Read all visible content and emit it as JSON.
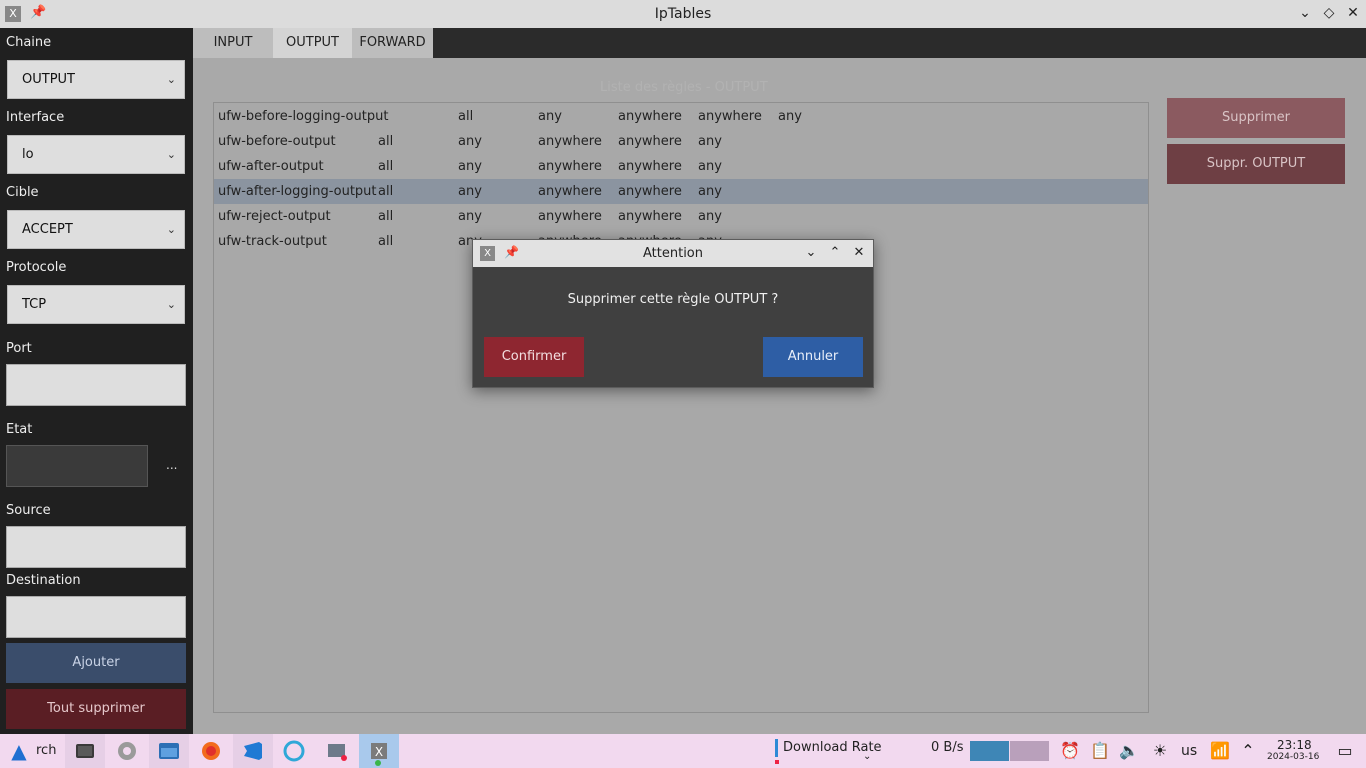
{
  "window": {
    "title": "IpTables",
    "app_icon_glyph": "X",
    "pin_glyph": "📌",
    "minimize_glyph": "⌄",
    "maximize_glyph": "◇",
    "close_glyph": "✕"
  },
  "left_panel": {
    "chaine_label": "Chaine",
    "chaine_value": "OUTPUT",
    "interface_label": "Interface",
    "interface_value": "lo",
    "cible_label": "Cible",
    "cible_value": "ACCEPT",
    "protocole_label": "Protocole",
    "protocole_value": "TCP",
    "port_label": "Port",
    "port_value": "",
    "etat_label": "Etat",
    "etat_value": "",
    "etat_more": "...",
    "source_label": "Source",
    "source_value": "",
    "destination_label": "Destination",
    "destination_value": "",
    "add_button": "Ajouter",
    "clear_all_button": "Tout supprimer",
    "chevron_glyph": "⌄"
  },
  "tabs": [
    "INPUT",
    "OUTPUT",
    "FORWARD"
  ],
  "active_tab": "OUTPUT",
  "main": {
    "faded_title": "Liste des règles - OUTPUT",
    "rows": [
      [
        "ufw-before-logging-output",
        "",
        "all",
        "any",
        "anywhere",
        "anywhere",
        "any"
      ],
      [
        "ufw-before-output",
        "all",
        "any",
        "anywhere",
        "anywhere",
        "any",
        ""
      ],
      [
        "ufw-after-output",
        "all",
        "any",
        "anywhere",
        "anywhere",
        "any",
        ""
      ],
      [
        "ufw-after-logging-output",
        "all",
        "any",
        "anywhere",
        "anywhere",
        "any",
        ""
      ],
      [
        "ufw-reject-output",
        "all",
        "any",
        "anywhere",
        "anywhere",
        "any",
        ""
      ],
      [
        "ufw-track-output",
        "all",
        "any",
        "anywhere",
        "anywhere",
        "any",
        ""
      ]
    ],
    "selected_row": 3,
    "delete_button": "Supprimer",
    "delete_output_button": "Suppr. OUTPUT"
  },
  "dialog": {
    "title": "Attention",
    "message": "Supprimer cette règle OUTPUT ?",
    "confirm_button": "Confirmer",
    "cancel_button": "Annuler",
    "minimize_glyph": "⌄",
    "maximize_glyph": "⌃",
    "close_glyph": "✕"
  },
  "taskbar": {
    "launcher_label": "rch",
    "download_label": "Download Rate",
    "download_value": "0 B/s",
    "keyboard_layout": "us",
    "time": "23:18",
    "date": "2024-03-16"
  },
  "colors": {
    "confirm": "#8e2630",
    "cancel": "#2e5ea5",
    "selected_row": "#8b94a0",
    "taskbar": "#f2d9ef"
  }
}
